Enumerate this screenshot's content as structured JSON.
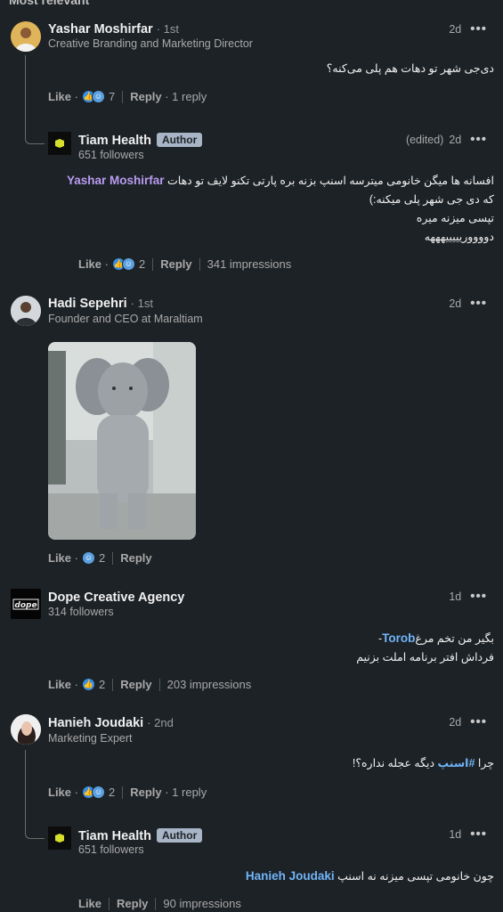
{
  "section_heading": "Most relevant",
  "comments": [
    {
      "name": "Yashar Moshirfar",
      "degree": "· 1st",
      "title": "Creative Branding and Marketing Director",
      "time": "2d",
      "text": "دی‌جی شهر تو دهات هم پلی می‌کنه؟",
      "like": "Like",
      "reaction_count": "7",
      "reply": "Reply",
      "replies": "1 reply"
    },
    {
      "name": "Tiam Health",
      "badge": "Author",
      "followers": "651 followers",
      "edited": "(edited)",
      "time": "2d",
      "mention": "Yashar Moshirfar",
      "line1": "افسانه ها میگن خانومی میترسه اسنپ بزنه بره پارتی تکنو لایف تو دهات",
      "line2": "که دی جی شهر پلی میکنه:)",
      "line3": "تپسی میزنه میره",
      "line4": "دووووریییییهههه",
      "like": "Like",
      "reaction_count": "2",
      "reply": "Reply",
      "impressions": "341 impressions"
    },
    {
      "name": "Hadi Sepehri",
      "degree": "· 1st",
      "title": "Founder and CEO at Maraltiam",
      "time": "2d",
      "like": "Like",
      "reaction_count": "2",
      "reply": "Reply"
    },
    {
      "name": "Dope Creative Agency",
      "logo_text": "dope",
      "followers": "314 followers",
      "time": "1d",
      "mention": "Torob",
      "line1": "- ",
      "line1b": " بگیر من تخم مرغ",
      "line2": "فرداش افتر برنامه املت بزنیم",
      "like": "Like",
      "reaction_count": "2",
      "reply": "Reply",
      "impressions": "203 impressions"
    },
    {
      "name": "Hanieh Joudaki",
      "degree": "· 2nd",
      "title": "Marketing Expert",
      "time": "2d",
      "pre": "چرا",
      "hashtag": "#اسنپ",
      "post": "دیگه عجله نداره؟!",
      "like": "Like",
      "reaction_count": "2",
      "reply": "Reply",
      "replies": "1 reply"
    },
    {
      "name": "Tiam Health",
      "badge": "Author",
      "followers": "651 followers",
      "time": "1d",
      "mention": "Hanieh Joudaki",
      "text": "چون خانومی تپسی میزنه نه اسنپ",
      "like": "Like",
      "reply": "Reply",
      "impressions": "90 impressions"
    }
  ],
  "more_icon": "ellipsis-icon",
  "colors": {
    "bg": "#1d2226",
    "mention": "#b99bf1",
    "link": "#70b5f9",
    "badge": "#a8b5c6"
  }
}
